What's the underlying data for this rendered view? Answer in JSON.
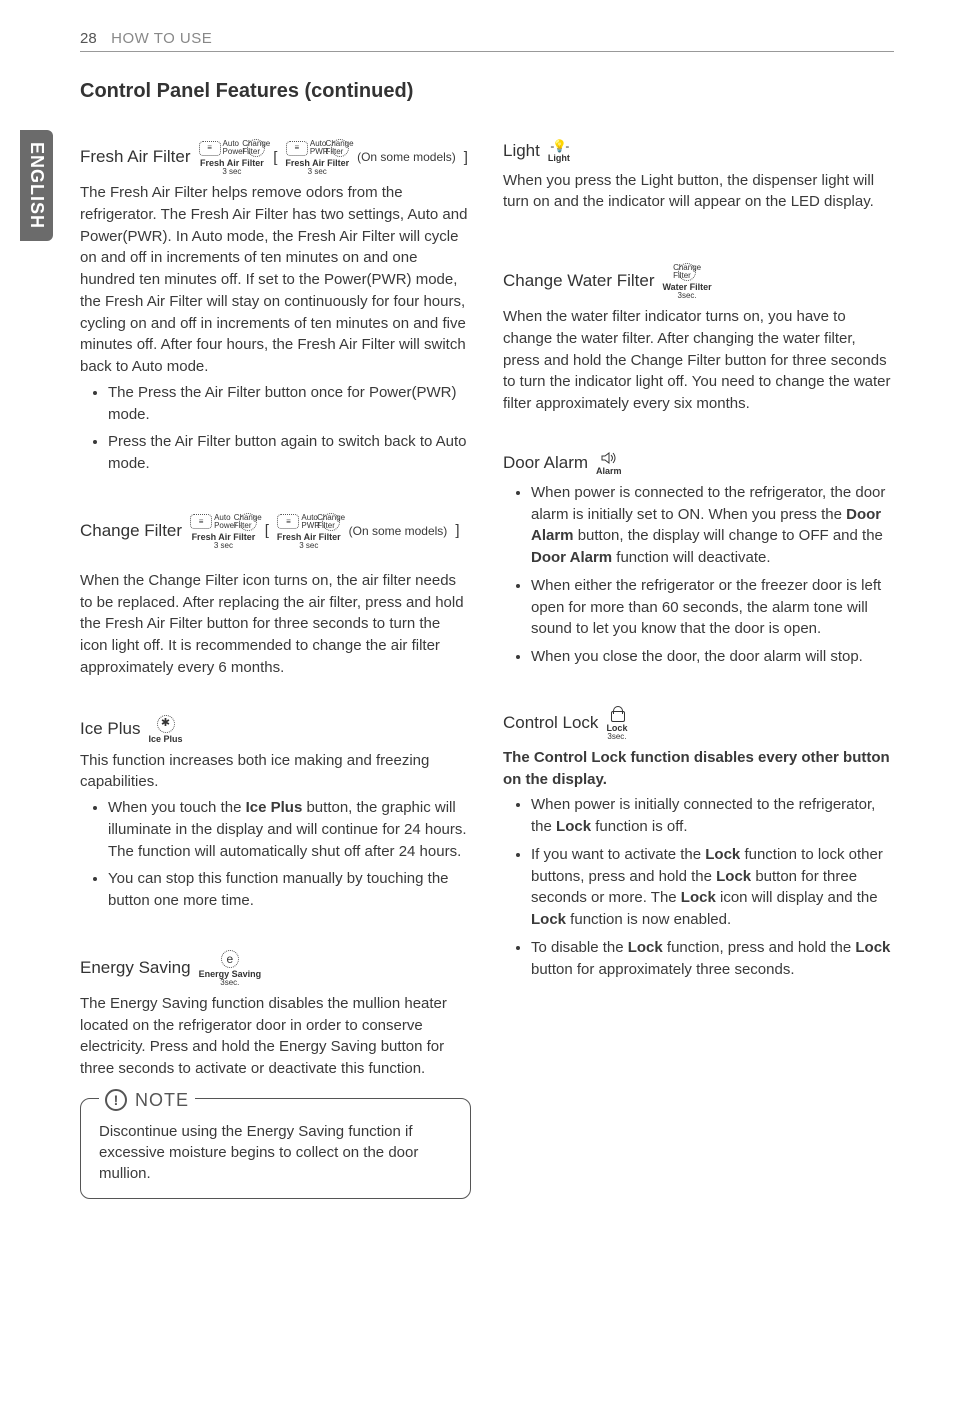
{
  "header": {
    "page": "28",
    "section": "HOW TO USE"
  },
  "side_tab": "ENGLISH",
  "title": "Control Panel Features (continued)",
  "left": {
    "freshAirFilter": {
      "head": "Fresh Air Filter",
      "iconCaption": "Fresh Air Filter",
      "iconSub": "3 sec",
      "auto": "Auto",
      "power": "Power",
      "pwr": "PWR",
      "change": "Change Filter",
      "onsome": "(On some models)",
      "body": "The Fresh Air Filter helps remove odors from the refrigerator. The Fresh Air Filter has two settings, Auto and Power(PWR). In Auto mode, the Fresh Air Filter will cycle on and off in increments of ten minutes on and one hundred ten minutes off. If set to the Power(PWR) mode, the Fresh Air Filter will stay on continuously for four hours, cycling on and off in increments of ten minutes on and five minutes off. After four hours, the Fresh Air Filter will switch back to Auto mode.",
      "b1": "The Press the Air Filter button once for Power(PWR) mode.",
      "b2": "Press the Air Filter button again to switch back to Auto mode."
    },
    "changeFilter": {
      "head": "Change Filter",
      "iconCaption": "Fresh Air Filter",
      "iconSub": "3 sec",
      "onsome": "(On some models)",
      "body": "When the Change Filter icon turns on, the air filter needs to be replaced. After replacing the air filter, press and hold the Fresh Air Filter button for three seconds to turn the icon light off. It is recommended to change the air filter approximately every 6 months."
    },
    "icePlus": {
      "head": "Ice Plus",
      "iconCaption": "Ice Plus",
      "body": "This function increases both ice making and freezing capabilities.",
      "b1a": "When you touch the ",
      "b1bold": "Ice Plus",
      "b1b": " button, the graphic will illuminate in the display and will continue for 24 hours. The function will automatically shut off after 24 hours.",
      "b2": "You can stop this function manually by touching the button one more time."
    },
    "energySaving": {
      "head": "Energy Saving",
      "iconCaption": "Energy Saving",
      "iconSub": "3sec.",
      "body": "The Energy Saving function disables the mullion heater located on the refrigerator door in order to conserve electricity. Press and hold the Energy Saving button for three seconds to activate or deactivate this function."
    },
    "note": {
      "title": "NOTE",
      "body": "Discontinue using the Energy Saving function if excessive moisture begins to collect on the door mullion."
    }
  },
  "right": {
    "light": {
      "head": "Light",
      "iconCaption": "Light",
      "body": "When you press the Light button, the dispenser light will turn on and the indicator will appear on the LED display."
    },
    "changeWater": {
      "head": "Change Water Filter",
      "iconCaption": "Water Filter",
      "iconSub": "3sec.",
      "iconTop": "Change Filter",
      "body": "When the water filter indicator turns on, you have to change the water filter. After changing the water filter, press and hold the Change Filter button for three seconds to turn the indicator light off. You need to change the water filter approximately every six months."
    },
    "doorAlarm": {
      "head": "Door Alarm",
      "iconCaption": "Alarm",
      "b1a": "When power is connected to the refrigerator, the door alarm is initially set to ON. When you press the ",
      "b1bold1": "Door Alarm",
      "b1b": " button, the display will change to OFF and the ",
      "b1bold2": "Door Alarm",
      "b1c": " function will deactivate.",
      "b2": "When either the refrigerator or the freezer door is left open for more than 60 seconds, the alarm tone will sound to let you know that the door is open.",
      "b3": "When you close the door, the door alarm will stop."
    },
    "controlLock": {
      "head": "Control Lock",
      "iconCaption": "Lock",
      "iconSub": "3sec.",
      "intro": "The Control Lock function disables every other button on the display.",
      "b1a": "When power is initially connected to the refrigerator, the ",
      "b1bold": "Lock",
      "b1b": " function is off.",
      "b2a": "If you want to activate the ",
      "b2bold1": "Lock",
      "b2b": " function to lock other buttons, press and hold the ",
      "b2bold2": "Lock",
      "b2c": " button for three seconds or more. The ",
      "b2bold3": "Lock",
      "b2d": " icon will display and the ",
      "b2bold4": "Lock",
      "b2e": " function is now enabled.",
      "b3a": "To disable the ",
      "b3bold1": "Lock",
      "b3b": " function, press and hold the ",
      "b3bold2": "Lock",
      "b3c": "  button for approximately three seconds."
    }
  }
}
